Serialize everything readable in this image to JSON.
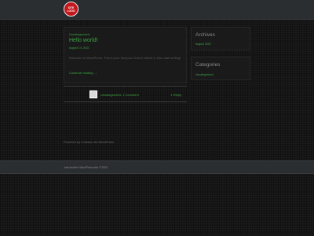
{
  "site": {
    "logo_text": "SITE LOGO"
  },
  "post": {
    "category": "Uncategorized",
    "title": "Hello world!",
    "date": "August 14, 2022",
    "excerpt": "Welcome to WordPress. This is your first post. Edit or delete it, then start writing!",
    "continue_label": "Continue reading →",
    "meta": "Uncategorized, 1 Comment",
    "reply_label": "1 Reply"
  },
  "sidebar": {
    "archives": {
      "title": "Archives",
      "items": [
        "August 2022"
      ]
    },
    "categories": {
      "title": "Categories",
      "items": [
        "Uncategorized"
      ]
    }
  },
  "footer": {
    "powered_by": "Powered by Fontsion for WordPress",
    "copyright": "Just another WordPress site © 2022"
  },
  "colors": {
    "accent": "#3da643",
    "bar": "#2b2e31",
    "logo": "#c4161c"
  }
}
